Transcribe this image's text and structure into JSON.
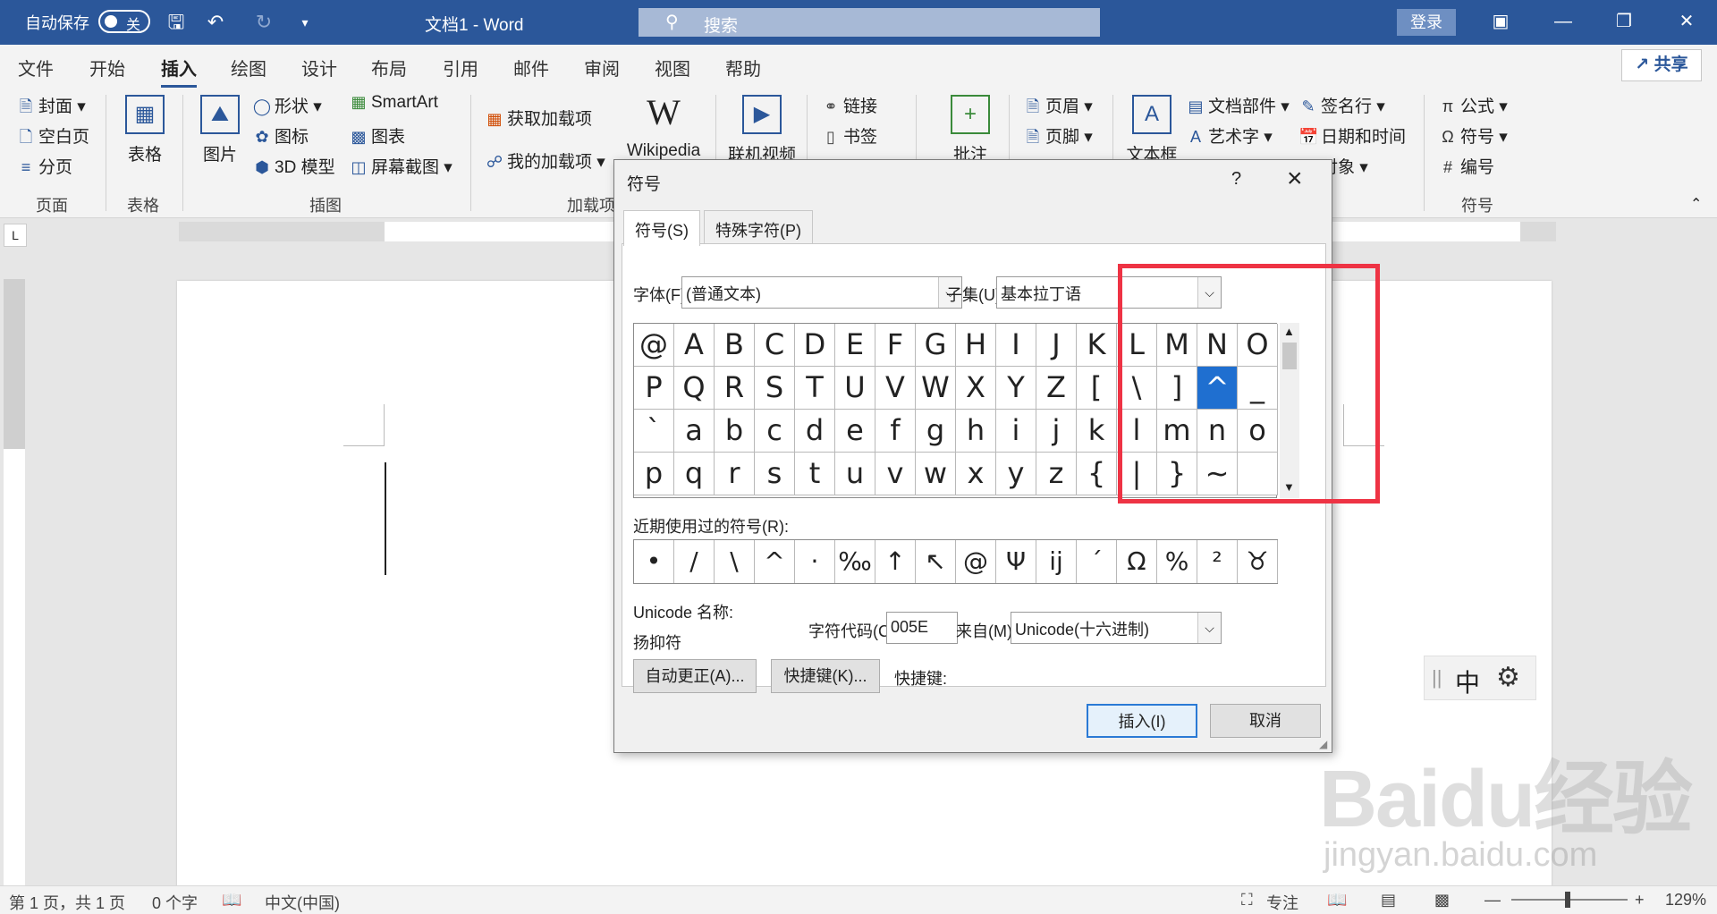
{
  "titlebar": {
    "autosave": "自动保存",
    "toggle": "关",
    "doc_title": "文档1  -  Word",
    "search": "搜索",
    "signin": "登录"
  },
  "tabs": [
    "文件",
    "开始",
    "插入",
    "绘图",
    "设计",
    "布局",
    "引用",
    "邮件",
    "审阅",
    "视图",
    "帮助"
  ],
  "active_tab": "插入",
  "share": "共享",
  "ribbon": {
    "pages": {
      "cover": "封面",
      "blank": "空白页",
      "break": "分页",
      "label": "页面"
    },
    "table": {
      "btn": "表格",
      "label": "表格"
    },
    "illustrations": {
      "picture": "图片",
      "shapes": "形状",
      "icons": "图标",
      "model3d": "3D 模型",
      "smartart": "SmartArt",
      "chart": "图表",
      "screenshot": "屏幕截图",
      "label": "插图"
    },
    "addins": {
      "get": "获取加载项",
      "mine": "我的加载项",
      "wikipedia": "Wikipedia",
      "label": "加载项"
    },
    "media": {
      "video": "联机视频"
    },
    "links": {
      "link": "链接",
      "bookmark": "书签"
    },
    "comments": {
      "comment": "批注"
    },
    "headerfooter": {
      "header": "页眉",
      "footer": "页脚"
    },
    "text": {
      "textbox": "文本框",
      "parts": "文档部件",
      "wordart": "艺术字",
      "signature": "签名行",
      "datetime": "日期和时间",
      "object": "对象"
    },
    "symbols": {
      "equation": "公式",
      "symbol": "符号",
      "number": "编号",
      "label": "符号"
    }
  },
  "dialog": {
    "title": "符号",
    "help": "?",
    "tab_symbols": "符号(S)",
    "tab_special": "特殊字符(P)",
    "font_label": "字体(F):",
    "font_value": "(普通文本)",
    "subset_label": "子集(U):",
    "subset_value": "基本拉丁语",
    "grid": [
      [
        "@",
        "A",
        "B",
        "C",
        "D",
        "E",
        "F",
        "G",
        "H",
        "I",
        "J",
        "K",
        "L",
        "M",
        "N",
        "O"
      ],
      [
        "P",
        "Q",
        "R",
        "S",
        "T",
        "U",
        "V",
        "W",
        "X",
        "Y",
        "Z",
        "[",
        "\\",
        "]",
        "^",
        "_"
      ],
      [
        "`",
        "a",
        "b",
        "c",
        "d",
        "e",
        "f",
        "g",
        "h",
        "i",
        "j",
        "k",
        "l",
        "m",
        "n",
        "o"
      ],
      [
        "p",
        "q",
        "r",
        "s",
        "t",
        "u",
        "v",
        "w",
        "x",
        "y",
        "z",
        "{",
        "|",
        "}",
        "~",
        ""
      ]
    ],
    "selected": "^",
    "recent_label": "近期使用过的符号(R):",
    "recent": [
      "•",
      "/",
      "\\",
      "^",
      "·",
      "‰",
      "↑",
      "↖",
      "@",
      "Ψ",
      "ĳ",
      "´",
      "Ω",
      "%",
      "²",
      "♉"
    ],
    "unicode_name_label": "Unicode 名称:",
    "unicode_name": "扬抑符",
    "charcode_label": "字符代码(C):",
    "charcode": "005E",
    "from_label": "来自(M):",
    "from_value": "Unicode(十六进制)",
    "autocorrect": "自动更正(A)...",
    "shortcut_btn": "快捷键(K)...",
    "shortcut_label": "快捷键:",
    "insert": "插入(I)",
    "cancel": "取消"
  },
  "ime": {
    "lang": "中"
  },
  "watermark": {
    "brand": "Baidu经验",
    "url": "jingyan.baidu.com"
  },
  "status": {
    "page": "第 1 页，共 1 页",
    "words": "0 个字",
    "language": "中文(中国)",
    "focus": "专注",
    "zoom": "129%"
  },
  "colors": {
    "word_blue": "#2b579a",
    "highlight": "#1f6fd0",
    "annotation": "#ee3344"
  }
}
